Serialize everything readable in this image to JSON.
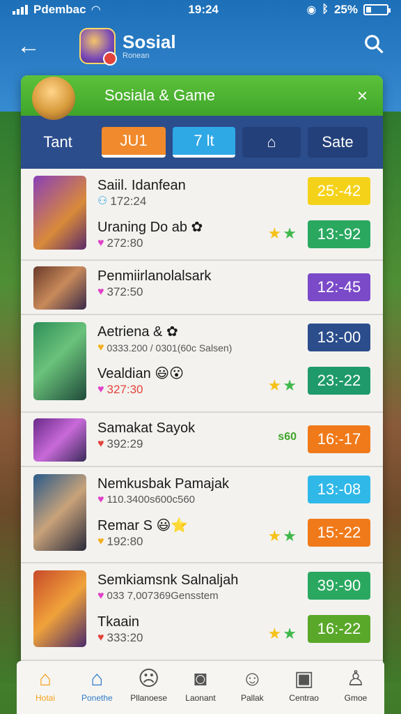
{
  "status": {
    "carrier": "Pdembac",
    "time": "19:24",
    "battery_pct": "25%",
    "battery_level": 0.25
  },
  "header": {
    "title": "Sosial",
    "subtitle": "Ronean"
  },
  "panel": {
    "title": "Sosiala & Game",
    "close": "×"
  },
  "tabs": [
    {
      "label": "Tant"
    },
    {
      "label": "JU1"
    },
    {
      "label": "7 lt"
    },
    {
      "label": "⌂"
    },
    {
      "label": "Sate"
    }
  ],
  "rows": [
    {
      "name": "Saiil. Idanfean",
      "meta": "172:24",
      "sub_name": "Uraning Do ab ✿",
      "sub_meta": "272:80",
      "badge_top": "25:-42",
      "badge_bottom": "13:-92"
    },
    {
      "name": "Penmiirlanolalsark",
      "meta": "372:50",
      "badge_top": "12:-45"
    },
    {
      "name": "Aetriena & ✿",
      "meta": "0333.200 / 0301(60c Salsen)",
      "sub_name": "Vealdian 😃😮",
      "sub_meta": "327:30",
      "badge_top": "13:-00",
      "badge_bottom": "23:-22"
    },
    {
      "name": "Samakat Sayok",
      "meta": "392:29",
      "score": "s60",
      "badge_top": "16:-17"
    },
    {
      "name": "Nemkusbak Pamajak",
      "meta": "110.3400s600c560",
      "sub_name": "Remar S 😃⭐",
      "sub_meta": "192:80",
      "badge_top": "13:-08",
      "badge_bottom": "15:-22"
    },
    {
      "name": "Semkiamsnk Salnaljah",
      "meta": "033 7,007369Gensstem",
      "sub_name": "Tkaain",
      "sub_meta": "333:20",
      "badge_top": "39:-90",
      "badge_bottom": "16:-22"
    }
  ],
  "nav": [
    {
      "label": "Hotai",
      "icon": "home-icon"
    },
    {
      "label": "Ponethe",
      "icon": "house-outline-icon"
    },
    {
      "label": "Pllanoese",
      "icon": "face-icon"
    },
    {
      "label": "Laonant",
      "icon": "chat-icon"
    },
    {
      "label": "Pallak",
      "icon": "bell-face-icon"
    },
    {
      "label": "Centrao",
      "icon": "notification-icon"
    },
    {
      "label": "Gmoe",
      "icon": "profile-icon"
    }
  ]
}
